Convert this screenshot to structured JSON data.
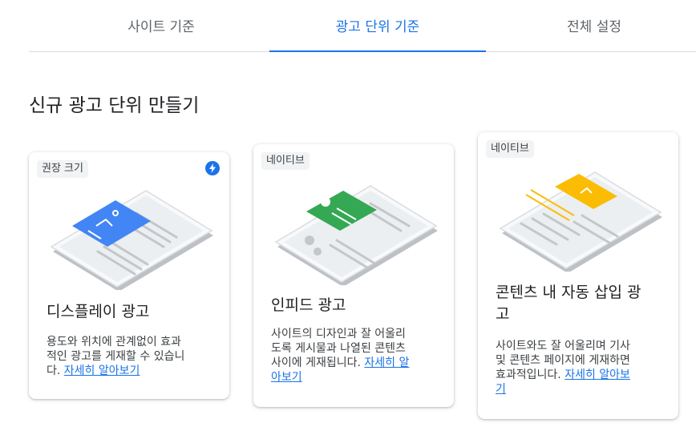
{
  "tabs": [
    {
      "label": "사이트 기준"
    },
    {
      "label": "광고 단위 기준"
    },
    {
      "label": "전체 설정"
    }
  ],
  "page_title": "신규 광고 단위 만들기",
  "cards": [
    {
      "chip": "권장 크기",
      "title": "디스플레이 광고",
      "desc_lines": [
        "용도와 위치에 관계없이 효과",
        "적인 광고를 게재할 수 있습니",
        "다. "
      ],
      "learn_more": "자세히 알아보기",
      "accent": "#4285f4",
      "badge_icon": "bolt-icon"
    },
    {
      "chip": "네이티브",
      "title": "인피드 광고",
      "desc_lines": [
        "사이트의 디자인과 잘 어울리",
        "도록 게시물과 나열된 콘텐츠",
        "사이에 게재됩니다. "
      ],
      "learn_more_lines": [
        "자세히 알",
        "아보기"
      ],
      "accent": "#34a853"
    },
    {
      "chip": "네이티브",
      "title_lines": [
        "콘텐츠 내 자동 삽입 광",
        "고"
      ],
      "desc_lines": [
        "사이트와도 잘 어울리며 기사",
        "및 콘텐츠 페이지에 게재하면",
        "효과적입니다. "
      ],
      "learn_more_lines": [
        "자세히 알아보",
        "기"
      ],
      "accent": "#fbbc04"
    }
  ]
}
